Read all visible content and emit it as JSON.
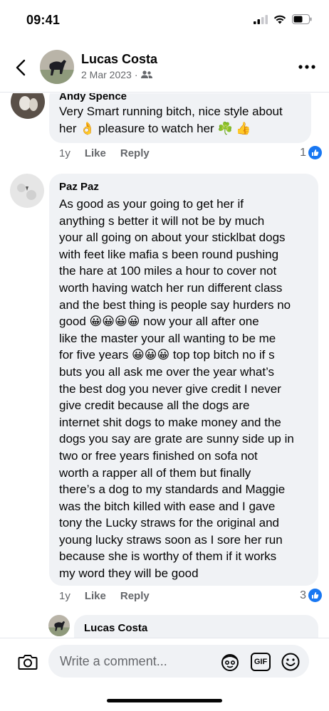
{
  "status_bar": {
    "time": "09:41"
  },
  "header": {
    "name": "Lucas Costa",
    "date": "2 Mar 2023",
    "separator": "·",
    "audience_icon": "friends-icon"
  },
  "comments": [
    {
      "author": "Andy Spence",
      "lines": [
        "Very Smart running bitch, nice style about",
        "her 👌 pleasure to watch her ☘️ 👍"
      ],
      "time": "1y",
      "like_label": "Like",
      "reply_label": "Reply",
      "reaction_count": "1"
    },
    {
      "author": "Paz Paz",
      "lines": [
        "As good as your going to get her if",
        "anything s better it will not be by much",
        "your all going on about your sticklbat dogs",
        "with feet like mafia s been round pushing",
        "the hare at 100 miles a hour to cover  not",
        "worth having watch her run different class",
        "and the best thing is people say hurders no",
        "good 😀😀😀😀 now your all after one",
        "like the master your all wanting to be me",
        "for five years 😀😀😀 top top bitch no if s",
        "buts you all ask me over the year what’s",
        "the best dog you never give credit I never",
        "give credit because all the dogs are",
        "internet shit dogs to make money and the",
        "dogs you say are grate are sunny side up in",
        "two or free years finished on sofa not",
        "worth a rapper all of them but finally",
        "there’s a dog to my standards and Maggie",
        "was the bitch killed with ease and I gave",
        "tony the Lucky straws for the original and",
        "young lucky straws soon as I sore her run",
        "because she is worthy of them if it works",
        "my word they will be good"
      ],
      "time": "1y",
      "like_label": "Like",
      "reply_label": "Reply",
      "reaction_count": "3"
    },
    {
      "author": "Lucas Costa"
    }
  ],
  "composer": {
    "placeholder": "Write a comment...",
    "gif_label": "GIF"
  },
  "colors": {
    "accent": "#1877f2",
    "bubble": "#f0f2f5",
    "secondary_text": "#65676b"
  }
}
